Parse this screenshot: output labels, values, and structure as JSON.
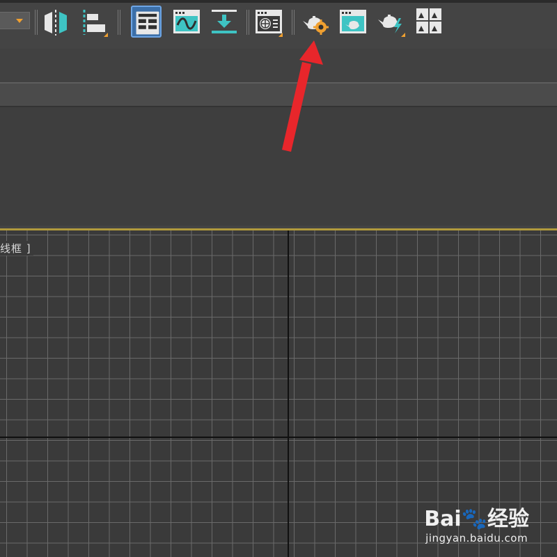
{
  "toolbar": {
    "buttons": [
      {
        "id": "mirror",
        "icon": "mirror-icon"
      },
      {
        "id": "align",
        "icon": "align-icon",
        "flyout": true
      },
      {
        "id": "scene-explorer",
        "icon": "scene-explorer-icon",
        "active": true
      },
      {
        "id": "curve-editor",
        "icon": "curve-editor-icon"
      },
      {
        "id": "schematic",
        "icon": "schematic-view-icon"
      },
      {
        "id": "material-editor",
        "icon": "material-editor-icon",
        "flyout": true
      },
      {
        "id": "render-setup",
        "icon": "render-setup-icon"
      },
      {
        "id": "rendered-frame-window",
        "icon": "rendered-frame-window-icon"
      },
      {
        "id": "render-production",
        "icon": "render-production-icon",
        "flyout": true
      },
      {
        "id": "viewport-layout",
        "icon": "viewport-layout-icon"
      }
    ],
    "accent_color": "#f0a030",
    "active_color": "#3c6fa8"
  },
  "viewport": {
    "label": "线框 ]",
    "border_color": "#b19a3c"
  },
  "annotation": {
    "arrow_color": "#e8262b",
    "target": "render-setup"
  },
  "watermark": {
    "logo_text": "Bai",
    "logo_text_2": "经验",
    "url": "jingyan.baidu.com"
  }
}
